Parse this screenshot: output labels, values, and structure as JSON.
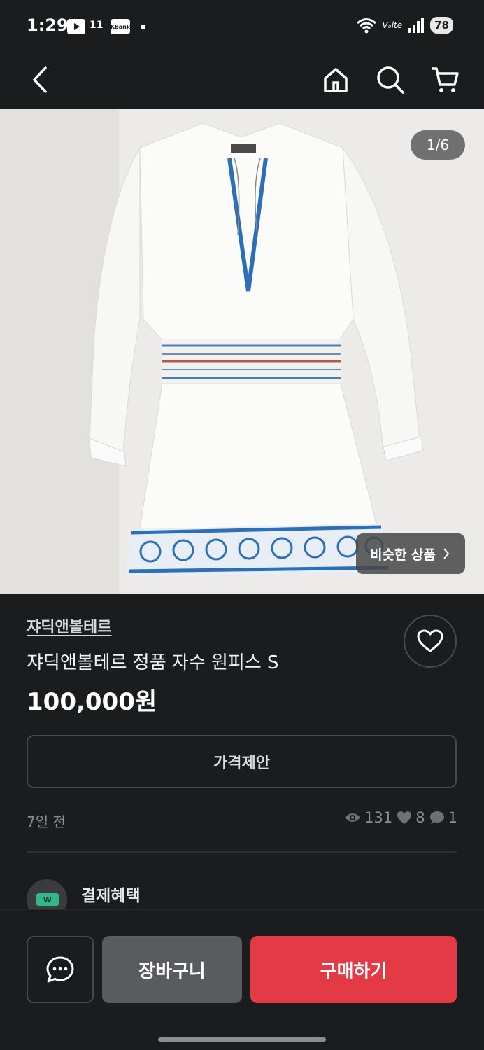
{
  "status_bar": {
    "time": "1:29",
    "app_11": "11",
    "app_kbank": "Kbank",
    "network": "Vₒlte",
    "battery": "78"
  },
  "product": {
    "image_counter": "1/6",
    "similar_label": "비슷한 상품",
    "brand": "쟈딕앤볼테르",
    "title": "쟈딕앤볼테르 정품 자수 원피스 S",
    "price": "100,000원",
    "offer_button": "가격제안",
    "posted": "7일 전",
    "views": "131",
    "likes": "8",
    "chats": "1"
  },
  "benefit": {
    "label": "결제혜택",
    "icon_text": "W"
  },
  "actions": {
    "cart": "장바구니",
    "buy": "구매하기"
  },
  "colors": {
    "background": "#1b1c1e",
    "buy_accent": "#e33a45",
    "cart_gray": "#5a5b5e"
  },
  "icons": [
    "back-icon",
    "home-icon",
    "search-icon",
    "cart-icon",
    "heart-icon",
    "eye-icon",
    "chat-bubble-icon",
    "chat-icon"
  ]
}
